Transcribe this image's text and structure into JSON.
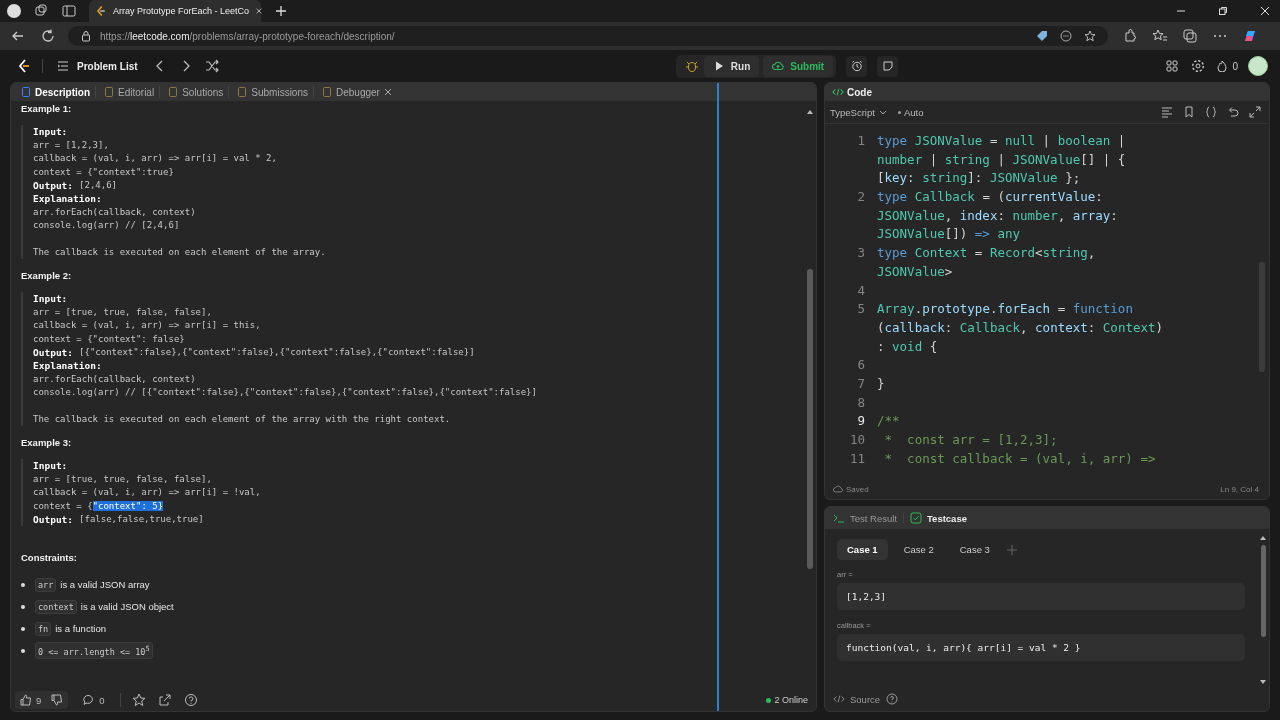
{
  "browser": {
    "tab_title": "Array Prototype ForEach - LeetCo",
    "url": {
      "scheme": "https://",
      "host": "leetcode.com",
      "path": "/problems/array-prototype-foreach/description/"
    }
  },
  "nav": {
    "problem_list": "Problem List",
    "run": "Run",
    "submit": "Submit",
    "streak": "0"
  },
  "left_tabs": [
    {
      "label": "Description",
      "selected": true,
      "closable": false
    },
    {
      "label": "Editorial",
      "selected": false,
      "closable": false
    },
    {
      "label": "Solutions",
      "selected": false,
      "closable": false
    },
    {
      "label": "Submissions",
      "selected": false,
      "closable": false
    },
    {
      "label": "Debugger",
      "selected": false,
      "closable": true
    }
  ],
  "examples": [
    {
      "title": "Example 1:",
      "lines": [
        {
          "kind": "label",
          "text": "Input:"
        },
        {
          "kind": "code",
          "text": "arr = [1,2,3],"
        },
        {
          "kind": "code",
          "text": "callback = (val, i, arr) => arr[i] = val * 2,"
        },
        {
          "kind": "code",
          "text": "context = {\"context\":true}"
        },
        {
          "kind": "label",
          "text": "Output:",
          "value": "[2,4,6]"
        },
        {
          "kind": "label",
          "text": "Explanation:"
        },
        {
          "kind": "code",
          "text": "arr.forEach(callback, context)"
        },
        {
          "kind": "code",
          "text": "console.log(arr) // [2,4,6]"
        },
        {
          "kind": "gap"
        },
        {
          "kind": "code",
          "text": "The callback is executed on each element of the array."
        }
      ]
    },
    {
      "title": "Example 2:",
      "lines": [
        {
          "kind": "label",
          "text": "Input:"
        },
        {
          "kind": "code",
          "text": "arr = [true, true, false, false],"
        },
        {
          "kind": "code",
          "text": "callback = (val, i, arr) => arr[i] = this,"
        },
        {
          "kind": "code",
          "text": "context = {\"context\": false}"
        },
        {
          "kind": "label",
          "text": "Output:",
          "value": "[{\"context\":false},{\"context\":false},{\"context\":false},{\"context\":false}]"
        },
        {
          "kind": "label",
          "text": "Explanation:"
        },
        {
          "kind": "code",
          "text": "arr.forEach(callback, context)"
        },
        {
          "kind": "code",
          "text": "console.log(arr) // [{\"context\":false},{\"context\":false},{\"context\":false},{\"context\":false}]"
        },
        {
          "kind": "gap"
        },
        {
          "kind": "code",
          "text": "The callback is executed on each element of the array with the right context."
        }
      ]
    },
    {
      "title": "Example 3:",
      "lines": [
        {
          "kind": "label",
          "text": "Input:"
        },
        {
          "kind": "code",
          "text": "arr = [true, true, false, false],"
        },
        {
          "kind": "code",
          "text": "callback = (val, i, arr) => arr[i] = !val,"
        },
        {
          "kind": "code",
          "text": "context = {",
          "highlight": "\"context\": 5}"
        },
        {
          "kind": "label",
          "text": "Output:",
          "value": "[false,false,true,true]"
        }
      ]
    }
  ],
  "constraints": {
    "title": "Constraints:",
    "items": [
      {
        "code": "arr",
        "text": "is a valid JSON array"
      },
      {
        "code": "context",
        "text": "is a valid JSON object"
      },
      {
        "code": "fn",
        "text": "is a function"
      },
      {
        "code": "0 <= arr.length <= 10$^{5}$"
      }
    ]
  },
  "footer": {
    "likes": "9",
    "comments": "0",
    "online": "2 Online"
  },
  "code_panel": {
    "title": "Code",
    "language": "TypeScript",
    "mode": "Auto",
    "status": "Saved",
    "cursor": "Ln 9, Col 4",
    "lines": [
      {
        "number": "1",
        "current": false,
        "rows": [
          {
            "segments": [
              {
                "text": "type ",
                "kind": "keyword"
              },
              {
                "text": "JSONValue",
                "kind": "type"
              },
              {
                "text": " = ",
                "kind": "plain"
              },
              {
                "text": "null",
                "kind": "type"
              },
              {
                "text": " | ",
                "kind": "plain"
              },
              {
                "text": "boolean",
                "kind": "type"
              },
              {
                "text": " |",
                "kind": "plain"
              }
            ]
          },
          {
            "segments": [
              {
                "text": "number",
                "kind": "type"
              },
              {
                "text": " | ",
                "kind": "plain"
              },
              {
                "text": "string",
                "kind": "type"
              },
              {
                "text": " | ",
                "kind": "plain"
              },
              {
                "text": "JSONValue",
                "kind": "type"
              },
              {
                "text": "[] | {",
                "kind": "plain"
              }
            ]
          },
          {
            "segments": [
              {
                "text": "[",
                "kind": "plain"
              },
              {
                "text": "key",
                "kind": "variable"
              },
              {
                "text": ": ",
                "kind": "plain"
              },
              {
                "text": "string",
                "kind": "type"
              },
              {
                "text": "]: ",
                "kind": "plain"
              },
              {
                "text": "JSONValue",
                "kind": "type"
              },
              {
                "text": " };",
                "kind": "plain"
              }
            ]
          }
        ]
      },
      {
        "number": "2",
        "current": false,
        "rows": [
          {
            "segments": [
              {
                "text": "type ",
                "kind": "keyword"
              },
              {
                "text": "Callback",
                "kind": "type"
              },
              {
                "text": " = (",
                "kind": "plain"
              },
              {
                "text": "currentValue",
                "kind": "variable"
              },
              {
                "text": ":",
                "kind": "plain"
              }
            ]
          },
          {
            "segments": [
              {
                "text": "JSONValue",
                "kind": "type"
              },
              {
                "text": ", ",
                "kind": "plain"
              },
              {
                "text": "index",
                "kind": "variable"
              },
              {
                "text": ": ",
                "kind": "plain"
              },
              {
                "text": "number",
                "kind": "type"
              },
              {
                "text": ", ",
                "kind": "plain"
              },
              {
                "text": "array",
                "kind": "variable"
              },
              {
                "text": ":",
                "kind": "plain"
              }
            ]
          },
          {
            "segments": [
              {
                "text": "JSONValue",
                "kind": "type"
              },
              {
                "text": "[]) ",
                "kind": "plain"
              },
              {
                "text": "=> ",
                "kind": "keyword"
              },
              {
                "text": "any",
                "kind": "type"
              }
            ]
          }
        ]
      },
      {
        "number": "3",
        "current": false,
        "rows": [
          {
            "segments": [
              {
                "text": "type ",
                "kind": "keyword"
              },
              {
                "text": "Context",
                "kind": "type"
              },
              {
                "text": " = ",
                "kind": "plain"
              },
              {
                "text": "Record",
                "kind": "type"
              },
              {
                "text": "<",
                "kind": "plain"
              },
              {
                "text": "string",
                "kind": "type"
              },
              {
                "text": ",",
                "kind": "plain"
              }
            ]
          },
          {
            "segments": [
              {
                "text": "JSONValue",
                "kind": "type"
              },
              {
                "text": ">",
                "kind": "plain"
              }
            ]
          }
        ]
      },
      {
        "number": "4",
        "current": false
      },
      {
        "number": "5",
        "current": false,
        "rows": [
          {
            "segments": [
              {
                "text": "Array",
                "kind": "type"
              },
              {
                "text": ".",
                "kind": "plain"
              },
              {
                "text": "prototype",
                "kind": "variable"
              },
              {
                "text": ".",
                "kind": "plain"
              },
              {
                "text": "forEach",
                "kind": "variable"
              },
              {
                "text": " = ",
                "kind": "plain"
              },
              {
                "text": "function",
                "kind": "keyword"
              }
            ]
          },
          {
            "segments": [
              {
                "text": "(",
                "kind": "plain"
              },
              {
                "text": "callback",
                "kind": "variable"
              },
              {
                "text": ": ",
                "kind": "plain"
              },
              {
                "text": "Callback",
                "kind": "type"
              },
              {
                "text": ", ",
                "kind": "plain"
              },
              {
                "text": "context",
                "kind": "variable"
              },
              {
                "text": ": ",
                "kind": "plain"
              },
              {
                "text": "Context",
                "kind": "type"
              },
              {
                "text": ")",
                "kind": "plain"
              }
            ]
          },
          {
            "segments": [
              {
                "text": ": ",
                "kind": "plain"
              },
              {
                "text": "void",
                "kind": "type"
              },
              {
                "text": " {",
                "kind": "plain"
              }
            ]
          }
        ]
      },
      {
        "number": "6",
        "current": false
      },
      {
        "number": "7",
        "current": false,
        "rows": [
          {
            "segments": [
              {
                "text": "}",
                "kind": "plain"
              }
            ]
          }
        ]
      },
      {
        "number": "8",
        "current": false
      },
      {
        "number": "9",
        "current": true,
        "rows": [
          {
            "segments": [
              {
                "text": "/**",
                "kind": "comment"
              }
            ]
          }
        ]
      },
      {
        "number": "10",
        "current": false,
        "rows": [
          {
            "segments": [
              {
                "text": " *  const arr = [1,2,3];",
                "kind": "comment"
              }
            ]
          }
        ]
      },
      {
        "number": "11",
        "current": false,
        "rows": [
          {
            "segments": [
              {
                "text": " *  const callback = (val, i, arr) =>",
                "kind": "comment"
              }
            ]
          }
        ]
      }
    ]
  },
  "test_panel": {
    "tabs": [
      {
        "label": "Test Result",
        "selected": false
      },
      {
        "label": "Testcase",
        "selected": true
      }
    ],
    "cases": [
      {
        "label": "Case 1",
        "selected": true
      },
      {
        "label": "Case 2",
        "selected": false
      },
      {
        "label": "Case 3",
        "selected": false
      }
    ],
    "params": [
      {
        "name": "arr =",
        "value": "[1,2,3]"
      },
      {
        "name": "callback =",
        "value": "function(val, i, arr){ arr[i] = val * 2 }"
      }
    ],
    "source": "Source"
  }
}
